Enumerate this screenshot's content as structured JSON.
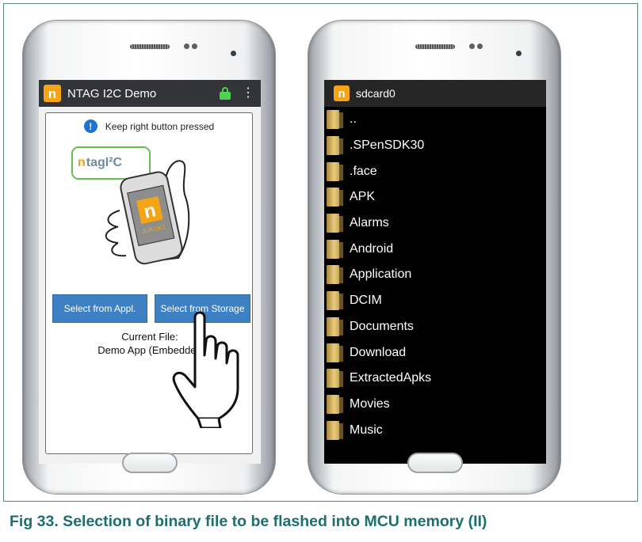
{
  "left_screen": {
    "app_title": "NTAG I2C Demo",
    "instruction": "Keep right button pressed",
    "info_icon_glyph": "!",
    "logo_glyph": "n",
    "badge": {
      "n": "n",
      "tag": "tag",
      "i2c": "I²C"
    },
    "phone_logo_glyph": "n",
    "phone_logo_text": "JUKUK1",
    "buttons": {
      "appl": "Select from Appl.",
      "storage": "Select from Storage"
    },
    "current_file_label": "Current File:",
    "current_file_value": "Demo App (Embedded",
    "colors": {
      "button": "#3d80c4",
      "app_bar": "#333437",
      "lock": "#4cd34f",
      "logo": "#f5a416"
    }
  },
  "right_screen": {
    "title": "sdcard0",
    "logo_glyph": "n",
    "folders": [
      {
        "name": ".."
      },
      {
        "name": ".SPenSDK30"
      },
      {
        "name": ".face"
      },
      {
        "name": "APK"
      },
      {
        "name": "Alarms"
      },
      {
        "name": "Android"
      },
      {
        "name": "Application"
      },
      {
        "name": "DCIM"
      },
      {
        "name": "Documents"
      },
      {
        "name": "Download"
      },
      {
        "name": "ExtractedApks"
      },
      {
        "name": "Movies"
      },
      {
        "name": "Music"
      }
    ]
  },
  "caption": "Fig 33.   Selection of binary file to be flashed into MCU memory (II)"
}
